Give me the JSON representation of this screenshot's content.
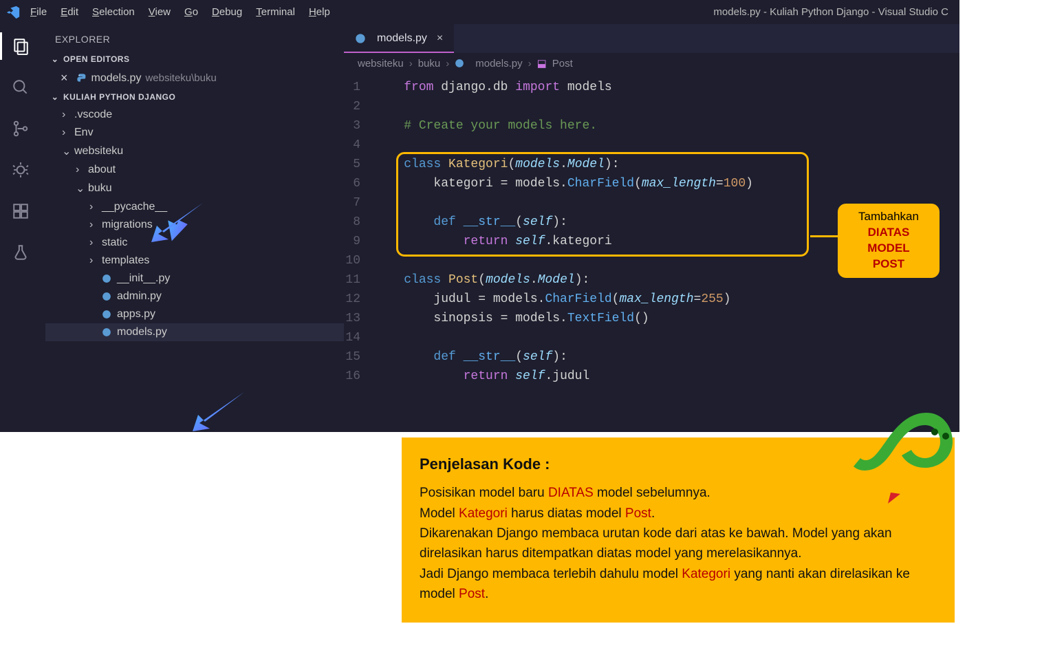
{
  "menu": {
    "file": "File",
    "edit": "Edit",
    "selection": "Selection",
    "view": "View",
    "go": "Go",
    "debug": "Debug",
    "terminal": "Terminal",
    "help": "Help"
  },
  "window_title": "models.py - Kuliah Python Django - Visual Studio C",
  "sidebar": {
    "title": "EXPLORER",
    "open_editors": "OPEN EDITORS",
    "open_file": "models.py",
    "open_file_path": "websiteku\\buku",
    "project": "KULIAH PYTHON DJANGO",
    "tree": {
      "vscode": ".vscode",
      "env": "Env",
      "websiteku": "websiteku",
      "about": "about",
      "buku": "buku",
      "pycache": "__pycache__",
      "migrations": "migrations",
      "static": "static",
      "templates": "templates",
      "init": "__init__.py",
      "admin": "admin.py",
      "apps": "apps.py",
      "models": "models.py"
    }
  },
  "tab": {
    "label": "models.py"
  },
  "breadcrumb": {
    "p1": "websiteku",
    "p2": "buku",
    "p3": "models.py",
    "p4": "Post"
  },
  "code": {
    "l1_from": "from",
    "l1_mod": " django.db ",
    "l1_import": "import",
    "l1_models": " models",
    "l3_cmt": "# Create your models here.",
    "l5_class": "class ",
    "l5_name": "Kategori",
    "l5_p1": "(",
    "l5_arg": "models",
    "l5_dot": ".",
    "l5_Model": "Model",
    "l5_p2": "):",
    "l6_txt": "        kategori = models.",
    "l6_fn": "CharField",
    "l6_p1": "(",
    "l6_kw": "max_length",
    "l6_eq": "=",
    "l6_num": "100",
    "l6_p2": ")",
    "l8_def": "def",
    "l8_name": " __str__",
    "l8_p1": "(",
    "l8_self": "self",
    "l8_p2": "):",
    "l9_ret": "return ",
    "l9_self": "self",
    "l9_dot": ".",
    "l9_attr": "kategori",
    "l11_class": "class ",
    "l11_name": "Post",
    "l11_p1": "(",
    "l11_arg": "models",
    "l11_dot": ".",
    "l11_Model": "Model",
    "l11_p2": "):",
    "l12_txt": "        judul = models.",
    "l12_fn": "CharField",
    "l12_p1": "(",
    "l12_kw": "max_length",
    "l12_eq": "=",
    "l12_num": "255",
    "l12_p2": ")",
    "l13_txt": "        sinopsis = models.",
    "l13_fn": "TextField",
    "l13_p": "()",
    "l15_def": "def",
    "l15_name": " __str__",
    "l15_p1": "(",
    "l15_self": "self",
    "l15_p2": "):",
    "l16_ret": "return ",
    "l16_self": "self",
    "l16_dot": ".",
    "l16_attr": "judul"
  },
  "annot": {
    "line1": "Tambahkan",
    "line2": "DIATAS",
    "line3": "MODEL",
    "line4": "POST"
  },
  "explain": {
    "title": "Penjelasan Kode :",
    "p1a": "Posisikan model baru ",
    "p1b": "DIATAS",
    "p1c": " model sebelumnya.",
    "p2a": "Model ",
    "p2b": "Kategori",
    "p2c": " harus diatas model ",
    "p2d": "Post",
    "p2e": ".",
    "p3": "Dikarenakan Django membaca urutan kode dari atas ke bawah. Model yang akan direlasikan harus ditempatkan diatas model yang merelasikannya.",
    "p4a": "Jadi Django membaca terlebih dahulu model ",
    "p4b": "Kategori",
    "p4c": " yang nanti akan direlasikan ke model ",
    "p4d": "Post",
    "p4e": "."
  }
}
